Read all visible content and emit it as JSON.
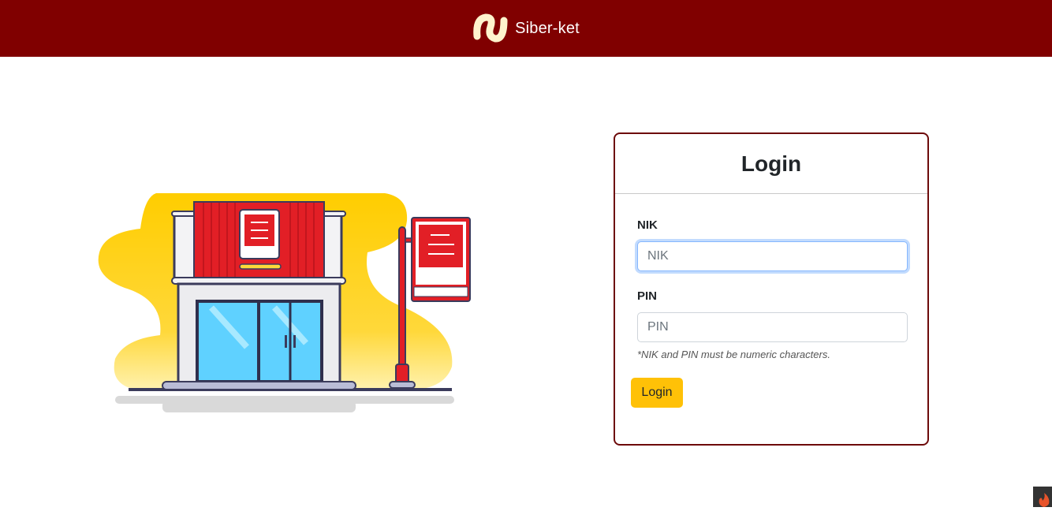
{
  "navbar": {
    "brand_name": "Siber-ket",
    "logo_icon": "siberket-logo-icon",
    "background_color": "#800000"
  },
  "illustration": {
    "name": "storefront-illustration"
  },
  "login": {
    "title": "Login",
    "nik": {
      "label": "NIK",
      "placeholder": "NIK",
      "value": ""
    },
    "pin": {
      "label": "PIN",
      "placeholder": "PIN",
      "value": ""
    },
    "hint": "*NIK and PIN must be numeric characters.",
    "button_label": "Login",
    "accent_color": "#ffc107",
    "border_color": "#6d0a0a"
  },
  "corner_badge": {
    "icon": "flame-icon"
  }
}
